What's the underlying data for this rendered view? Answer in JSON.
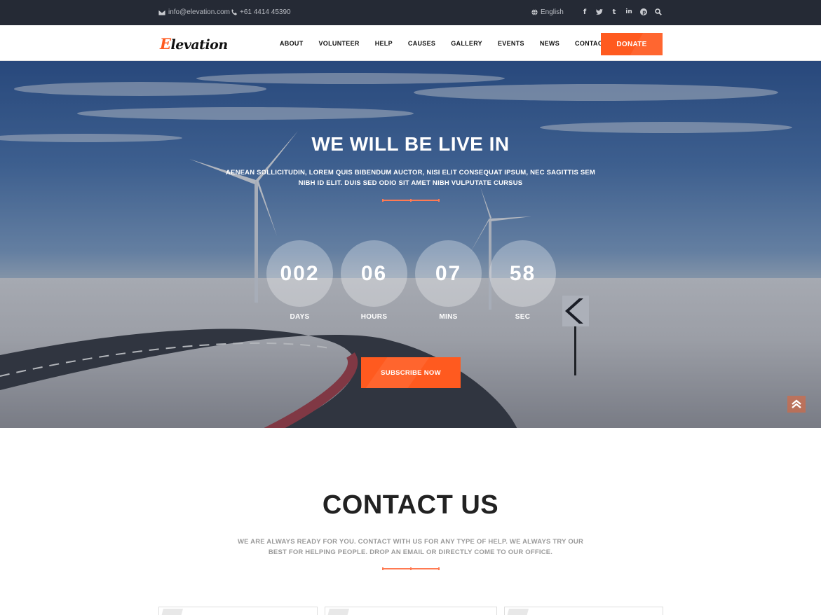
{
  "topbar": {
    "email": "info@elevation.com",
    "phone": "+61 4414 45390",
    "language": "English",
    "social_icons": [
      "facebook-icon",
      "twitter-icon",
      "tumblr-icon",
      "linkedin-icon",
      "pinterest-icon",
      "search-icon"
    ]
  },
  "header": {
    "logo_first": "E",
    "logo_rest": "levation",
    "nav": [
      "ABOUT",
      "VOLUNTEER",
      "HELP",
      "CAUSES",
      "GALLERY",
      "EVENTS",
      "NEWS",
      "CONTACT"
    ],
    "donate_label": "DONATE"
  },
  "hero": {
    "title": "WE WILL BE LIVE IN",
    "subtitle": "AENEAN SOLLICITUDIN, LOREM QUIS BIBENDUM AUCTOR, NISI ELIT CONSEQUAT IPSUM, NEC SAGITTIS SEM NIBH ID ELIT. DUIS SED ODIO SIT AMET NIBH VULPUTATE CURSUS",
    "countdown": [
      {
        "value": "002",
        "label": "DAYS"
      },
      {
        "value": "06",
        "label": "HOURS"
      },
      {
        "value": "07",
        "label": "MINS"
      },
      {
        "value": "58",
        "label": "SEC"
      }
    ],
    "subscribe_label": "SUBSCRIBE NOW"
  },
  "contact": {
    "title": "CONTACT US",
    "subtitle": "WE ARE ALWAYS READY FOR YOU. CONTACT WITH US FOR ANY TYPE OF HELP. WE ALWAYS TRY OUR BEST FOR HELPING PEOPLE. DROP AN EMAIL OR DIRECTLY COME TO OUR OFFICE."
  },
  "colors": {
    "accent": "#ff5a1f",
    "topbar_bg": "#252a35"
  }
}
